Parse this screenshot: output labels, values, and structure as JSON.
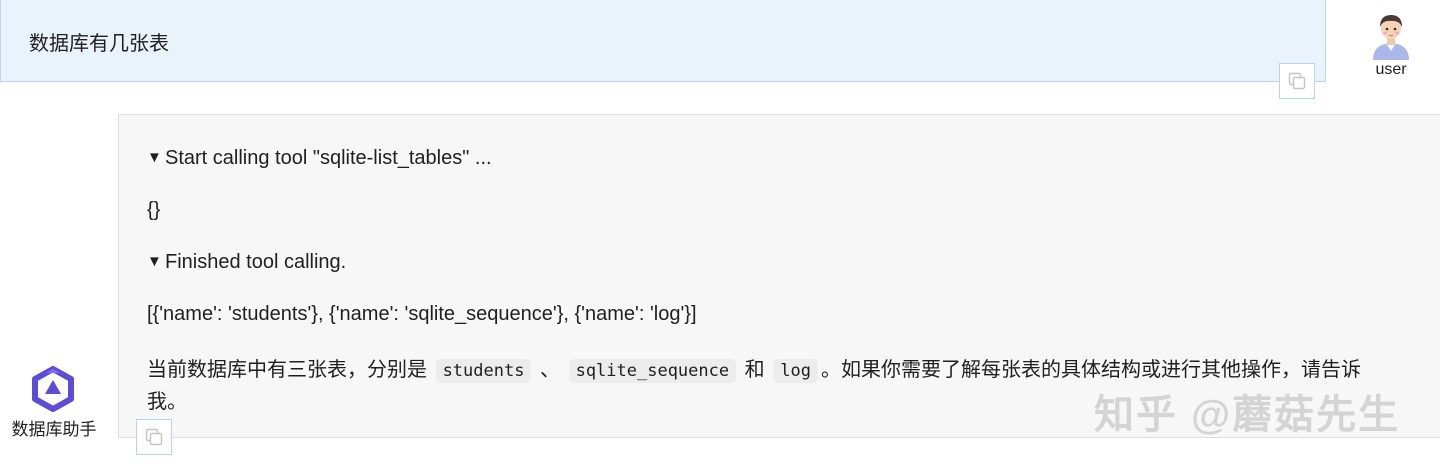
{
  "user": {
    "message": "数据库有几张表",
    "name": "user",
    "copy_icon": "copy-icon"
  },
  "bot": {
    "name": "数据库助手",
    "avatar_icon": "qwen-logo-icon",
    "copy_icon": "copy-icon",
    "lines": {
      "tool_start": "Start calling tool \"sqlite-list_tables\" ...",
      "tool_args": "{}",
      "tool_end": "Finished tool calling.",
      "tool_result": "[{'name': 'students'}, {'name': 'sqlite_sequence'}, {'name': 'log'}]"
    },
    "answer": {
      "part1": "当前数据库中有三张表，分别是",
      "code1": "students",
      "sep1": "、",
      "code2": "sqlite_sequence",
      "sep2": "和",
      "code3": "log",
      "part2": "。如果你需要了解每张表的具体结构或进行其他操作，请告诉",
      "part3": "我。"
    },
    "triangle": "▼"
  },
  "watermark": "知乎 @蘑菇先生",
  "colors": {
    "user_bg": "#eaf2fc",
    "user_border": "#bcd4ef",
    "bot_bg": "#f7f7f7",
    "bot_border": "#dddddd",
    "logo": "#5b4dd6"
  }
}
